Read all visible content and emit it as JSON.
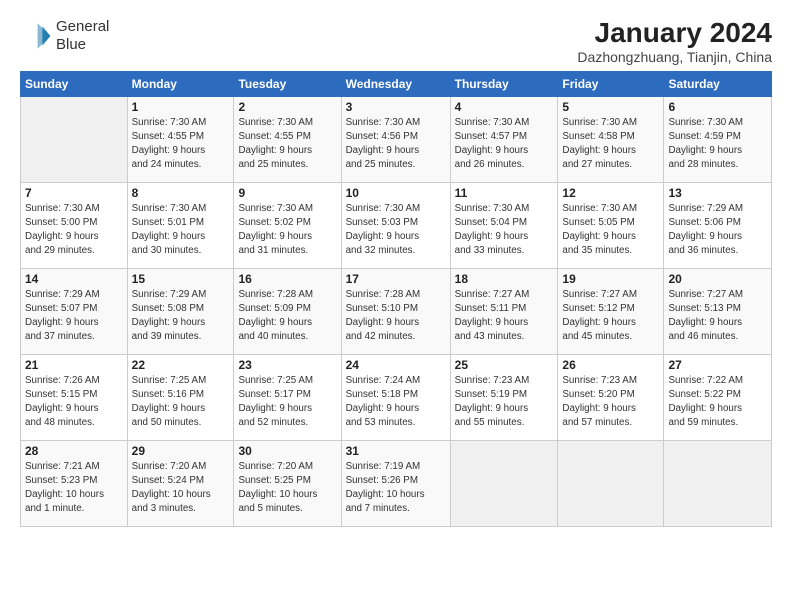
{
  "header": {
    "logo_line1": "General",
    "logo_line2": "Blue",
    "title": "January 2024",
    "subtitle": "Dazhongzhuang, Tianjin, China"
  },
  "days_of_week": [
    "Sunday",
    "Monday",
    "Tuesday",
    "Wednesday",
    "Thursday",
    "Friday",
    "Saturday"
  ],
  "weeks": [
    [
      {
        "day": "",
        "info": ""
      },
      {
        "day": "1",
        "info": "Sunrise: 7:30 AM\nSunset: 4:55 PM\nDaylight: 9 hours\nand 24 minutes."
      },
      {
        "day": "2",
        "info": "Sunrise: 7:30 AM\nSunset: 4:55 PM\nDaylight: 9 hours\nand 25 minutes."
      },
      {
        "day": "3",
        "info": "Sunrise: 7:30 AM\nSunset: 4:56 PM\nDaylight: 9 hours\nand 25 minutes."
      },
      {
        "day": "4",
        "info": "Sunrise: 7:30 AM\nSunset: 4:57 PM\nDaylight: 9 hours\nand 26 minutes."
      },
      {
        "day": "5",
        "info": "Sunrise: 7:30 AM\nSunset: 4:58 PM\nDaylight: 9 hours\nand 27 minutes."
      },
      {
        "day": "6",
        "info": "Sunrise: 7:30 AM\nSunset: 4:59 PM\nDaylight: 9 hours\nand 28 minutes."
      }
    ],
    [
      {
        "day": "7",
        "info": "Sunrise: 7:30 AM\nSunset: 5:00 PM\nDaylight: 9 hours\nand 29 minutes."
      },
      {
        "day": "8",
        "info": "Sunrise: 7:30 AM\nSunset: 5:01 PM\nDaylight: 9 hours\nand 30 minutes."
      },
      {
        "day": "9",
        "info": "Sunrise: 7:30 AM\nSunset: 5:02 PM\nDaylight: 9 hours\nand 31 minutes."
      },
      {
        "day": "10",
        "info": "Sunrise: 7:30 AM\nSunset: 5:03 PM\nDaylight: 9 hours\nand 32 minutes."
      },
      {
        "day": "11",
        "info": "Sunrise: 7:30 AM\nSunset: 5:04 PM\nDaylight: 9 hours\nand 33 minutes."
      },
      {
        "day": "12",
        "info": "Sunrise: 7:30 AM\nSunset: 5:05 PM\nDaylight: 9 hours\nand 35 minutes."
      },
      {
        "day": "13",
        "info": "Sunrise: 7:29 AM\nSunset: 5:06 PM\nDaylight: 9 hours\nand 36 minutes."
      }
    ],
    [
      {
        "day": "14",
        "info": "Sunrise: 7:29 AM\nSunset: 5:07 PM\nDaylight: 9 hours\nand 37 minutes."
      },
      {
        "day": "15",
        "info": "Sunrise: 7:29 AM\nSunset: 5:08 PM\nDaylight: 9 hours\nand 39 minutes."
      },
      {
        "day": "16",
        "info": "Sunrise: 7:28 AM\nSunset: 5:09 PM\nDaylight: 9 hours\nand 40 minutes."
      },
      {
        "day": "17",
        "info": "Sunrise: 7:28 AM\nSunset: 5:10 PM\nDaylight: 9 hours\nand 42 minutes."
      },
      {
        "day": "18",
        "info": "Sunrise: 7:27 AM\nSunset: 5:11 PM\nDaylight: 9 hours\nand 43 minutes."
      },
      {
        "day": "19",
        "info": "Sunrise: 7:27 AM\nSunset: 5:12 PM\nDaylight: 9 hours\nand 45 minutes."
      },
      {
        "day": "20",
        "info": "Sunrise: 7:27 AM\nSunset: 5:13 PM\nDaylight: 9 hours\nand 46 minutes."
      }
    ],
    [
      {
        "day": "21",
        "info": "Sunrise: 7:26 AM\nSunset: 5:15 PM\nDaylight: 9 hours\nand 48 minutes."
      },
      {
        "day": "22",
        "info": "Sunrise: 7:25 AM\nSunset: 5:16 PM\nDaylight: 9 hours\nand 50 minutes."
      },
      {
        "day": "23",
        "info": "Sunrise: 7:25 AM\nSunset: 5:17 PM\nDaylight: 9 hours\nand 52 minutes."
      },
      {
        "day": "24",
        "info": "Sunrise: 7:24 AM\nSunset: 5:18 PM\nDaylight: 9 hours\nand 53 minutes."
      },
      {
        "day": "25",
        "info": "Sunrise: 7:23 AM\nSunset: 5:19 PM\nDaylight: 9 hours\nand 55 minutes."
      },
      {
        "day": "26",
        "info": "Sunrise: 7:23 AM\nSunset: 5:20 PM\nDaylight: 9 hours\nand 57 minutes."
      },
      {
        "day": "27",
        "info": "Sunrise: 7:22 AM\nSunset: 5:22 PM\nDaylight: 9 hours\nand 59 minutes."
      }
    ],
    [
      {
        "day": "28",
        "info": "Sunrise: 7:21 AM\nSunset: 5:23 PM\nDaylight: 10 hours\nand 1 minute."
      },
      {
        "day": "29",
        "info": "Sunrise: 7:20 AM\nSunset: 5:24 PM\nDaylight: 10 hours\nand 3 minutes."
      },
      {
        "day": "30",
        "info": "Sunrise: 7:20 AM\nSunset: 5:25 PM\nDaylight: 10 hours\nand 5 minutes."
      },
      {
        "day": "31",
        "info": "Sunrise: 7:19 AM\nSunset: 5:26 PM\nDaylight: 10 hours\nand 7 minutes."
      },
      {
        "day": "",
        "info": ""
      },
      {
        "day": "",
        "info": ""
      },
      {
        "day": "",
        "info": ""
      }
    ]
  ]
}
